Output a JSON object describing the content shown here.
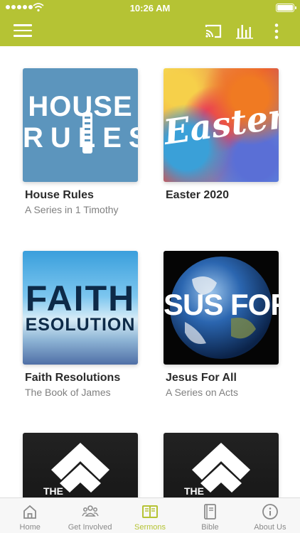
{
  "status_bar": {
    "time": "10:26 AM"
  },
  "colors": {
    "accent": "#b5c334",
    "tab_inactive": "#8a8a8a",
    "title_text": "#2b2b2b",
    "subtitle_text": "#808080"
  },
  "app_bar": {
    "icons": [
      "menu-icon",
      "cast-icon",
      "audio-bars-icon",
      "more-vertical-icon"
    ]
  },
  "series": [
    {
      "title": "House Rules",
      "subtitle": "A Series in 1 Timothy",
      "art_text_1": "HOUSE",
      "art_text_2": "RULES"
    },
    {
      "title": "Easter 2020",
      "subtitle": "",
      "art_text_1": "Easter"
    },
    {
      "title": "Faith Resolutions",
      "subtitle": "The Book of James",
      "art_text_1": "FAITH",
      "art_text_2": "ESOLUTION"
    },
    {
      "title": "Jesus For All",
      "subtitle": "A Series on Acts",
      "art_text_1": "SUS FOR A"
    },
    {
      "title": "",
      "subtitle": "",
      "art_text_1": "THE"
    },
    {
      "title": "",
      "subtitle": "",
      "art_text_1": "THE"
    }
  ],
  "tabs": [
    {
      "label": "Home",
      "icon": "home-icon",
      "active": false
    },
    {
      "label": "Get Involved",
      "icon": "people-icon",
      "active": false
    },
    {
      "label": "Sermons",
      "icon": "open-book-icon",
      "active": true
    },
    {
      "label": "Bible",
      "icon": "bible-icon",
      "active": false
    },
    {
      "label": "About Us",
      "icon": "info-icon",
      "active": false
    }
  ]
}
